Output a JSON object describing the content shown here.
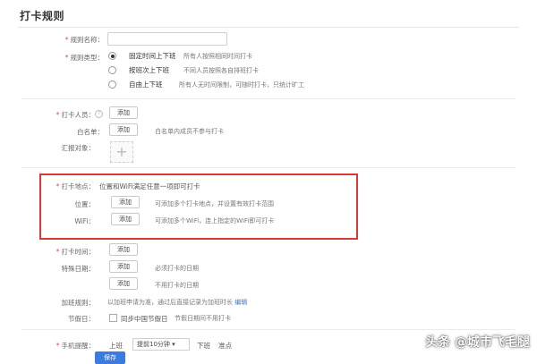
{
  "page_title": "打卡规则",
  "rule_name": {
    "label": "规则名称：",
    "value": ""
  },
  "rule_type": {
    "label": "规则类型：",
    "options": [
      {
        "title": "固定时间上下班",
        "desc": "所有人按照相同时间打卡",
        "checked": true
      },
      {
        "title": "按班次上下班",
        "desc": "不同人员按照各自排班打卡",
        "checked": false
      },
      {
        "title": "自由上下班",
        "desc": "所有人无时间限制，可随时打卡，只统计旷工",
        "checked": false
      }
    ]
  },
  "members": {
    "label": "打卡人员：",
    "add": "添加",
    "whitelist_label": "白名单：",
    "whitelist_add": "添加",
    "whitelist_hint": "白名单内成员不参与打卡",
    "report_label": "汇报对象：",
    "report_plus": "+"
  },
  "location": {
    "label": "打卡地点：",
    "desc": "位置和WiFi满足任意一项即可打卡",
    "position_label": "位置：",
    "position_add": "添加",
    "position_hint": "可添加多个打卡地点，并设置有效打卡范围",
    "wifi_label": "WiFi：",
    "wifi_add": "添加",
    "wifi_hint": "可添加多个WiFi，连上指定的WiFi即可打卡"
  },
  "schedule": {
    "time_label": "打卡时间：",
    "time_add": "添加",
    "special_label": "特殊日期：",
    "special_add_1": "添加",
    "special_hint_1": "必须打卡的日期",
    "special_add_2": "添加",
    "special_hint_2": "不用打卡的日期",
    "overtime_label": "加班规则：",
    "overtime_text": "以加班申请为准，通过后直接记录为加班时长",
    "overtime_link": "编辑",
    "holiday_label": "节假日：",
    "holiday_check": "同步中国节假日",
    "holiday_hint": "节假日期间不用打卡"
  },
  "reminder": {
    "label": "手机提醒：",
    "on_work": "上班",
    "select_value": "提前10分钟",
    "off_work": "下班",
    "off_value": "准点"
  },
  "footer": {
    "save": "保存"
  },
  "watermark": "头条 @城市飞毛腿",
  "colors": {
    "highlight": "#d83a34",
    "primary": "#3a7be0",
    "link": "#3b78c8"
  }
}
